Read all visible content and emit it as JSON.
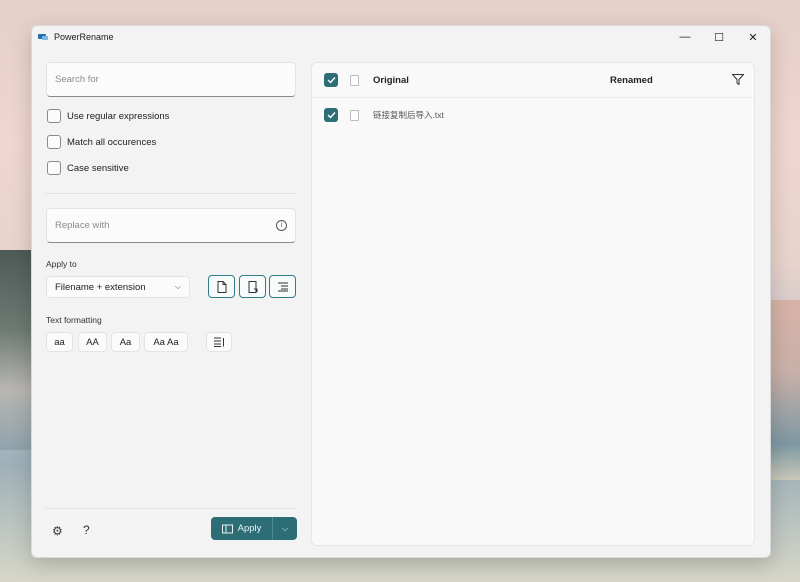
{
  "window": {
    "title": "PowerRename",
    "minimize": "—",
    "maximize": "☐",
    "close": "✕"
  },
  "search": {
    "placeholder": "Search for",
    "value": ""
  },
  "options": {
    "regex": "Use regular expressions",
    "match_all": "Match all occurences",
    "case_sensitive": "Case sensitive"
  },
  "replace": {
    "placeholder": "Replace with",
    "value": "",
    "info": "i"
  },
  "apply_to": {
    "label": "Apply to",
    "selected": "Filename + extension",
    "chevron": "⌵"
  },
  "text_formatting": {
    "label": "Text formatting",
    "lowercase": "aa",
    "uppercase": "AA",
    "titlecase": "Aa",
    "capitalize": "Aa Aa"
  },
  "bottom": {
    "settings_icon": "⚙",
    "help_icon": "?",
    "apply_label": "Apply",
    "split_chevron": "⌵"
  },
  "list": {
    "header_original": "Original",
    "header_renamed": "Renamed",
    "rows": [
      {
        "original": "链接复制后导入.txt",
        "renamed": "",
        "checked": true
      }
    ]
  },
  "colors": {
    "accent": "#2d6e76",
    "window_bg": "#f3f3f3"
  }
}
